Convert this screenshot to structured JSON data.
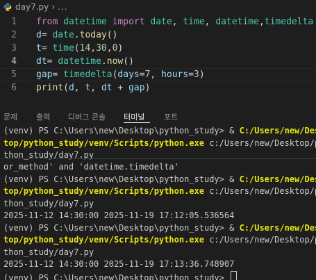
{
  "breadcrumb": {
    "file": "day7.py",
    "more": "..."
  },
  "editor": {
    "lines": [
      {
        "no": "1",
        "tokens": [
          [
            "kw",
            "from"
          ],
          [
            "pl",
            " "
          ],
          [
            "cls",
            "datetime"
          ],
          [
            "pl",
            " "
          ],
          [
            "kw",
            "import"
          ],
          [
            "pl",
            " "
          ],
          [
            "cls",
            "date"
          ],
          [
            "pl",
            ", "
          ],
          [
            "cls",
            "time"
          ],
          [
            "pl",
            ", "
          ],
          [
            "cls",
            "datetime"
          ],
          [
            "pl",
            ","
          ],
          [
            "cls",
            "timedelta"
          ]
        ]
      },
      {
        "no": "2",
        "tokens": [
          [
            "var",
            "d"
          ],
          [
            "pl",
            "= "
          ],
          [
            "cls",
            "date"
          ],
          [
            "pl",
            "."
          ],
          [
            "fn",
            "today"
          ],
          [
            "pl",
            "()"
          ]
        ]
      },
      {
        "no": "3",
        "tokens": [
          [
            "var",
            "t"
          ],
          [
            "pl",
            "= "
          ],
          [
            "cls",
            "time"
          ],
          [
            "pl",
            "("
          ],
          [
            "num",
            "14"
          ],
          [
            "pl",
            ","
          ],
          [
            "num",
            "30"
          ],
          [
            "pl",
            ","
          ],
          [
            "num",
            "0"
          ],
          [
            "pl",
            ")"
          ]
        ]
      },
      {
        "no": "4",
        "tokens": [
          [
            "var",
            "dt"
          ],
          [
            "pl",
            "= "
          ],
          [
            "cls",
            "datetime"
          ],
          [
            "pl",
            "."
          ],
          [
            "fn",
            "now"
          ],
          [
            "pl",
            "()"
          ]
        ]
      },
      {
        "no": "5",
        "tokens": [
          [
            "var",
            "gap"
          ],
          [
            "pl",
            "= "
          ],
          [
            "cls",
            "timedelta"
          ],
          [
            "pl",
            "("
          ],
          [
            "var",
            "days"
          ],
          [
            "pl",
            "="
          ],
          [
            "num",
            "7"
          ],
          [
            "pl",
            ", "
          ],
          [
            "var",
            "hours"
          ],
          [
            "pl",
            "="
          ],
          [
            "num",
            "3"
          ],
          [
            "pl",
            ")"
          ]
        ]
      },
      {
        "no": "6",
        "tokens": [
          [
            "fn",
            "print"
          ],
          [
            "pl",
            "("
          ],
          [
            "var",
            "d"
          ],
          [
            "pl",
            ", "
          ],
          [
            "var",
            "t"
          ],
          [
            "pl",
            ", "
          ],
          [
            "var",
            "dt"
          ],
          [
            "pl",
            " + "
          ],
          [
            "var",
            "gap"
          ],
          [
            "pl",
            ")"
          ]
        ]
      }
    ]
  },
  "panel": {
    "tabs": [
      "문제",
      "출력",
      "디버그 콘솔",
      "터미널",
      "포트"
    ],
    "active": "터미널"
  },
  "terminal": {
    "l0_prefix": "(venv) PS C:\\Users\\new\\Desktop\\python_study> & ",
    "l0_hl": "C:/Users/new/Desk",
    "l1_hl": "top/python_study/venv/Scripts/python.exe",
    "l1_rest": " c:/Users/new/Desktop/py",
    "l2": "thon_study/day7.py",
    "l3": "or_method' and 'datetime.timedelta'",
    "l4_prefix": "(venv) PS C:\\Users\\new\\Desktop\\python_study> & ",
    "l4_hl": "C:/Users/new/Desk",
    "l5_hl": "top/python_study/venv/Scripts/python.exe",
    "l5_rest": " c:/Users/new/Desktop/py",
    "l6": "thon_study/day7.py",
    "l7": "2025-11-12 14:30:00 2025-11-19 17:12:05.536564",
    "l8_prefix": "(venv) PS C:\\Users\\new\\Desktop\\python_study> & ",
    "l8_hl": "C:/Users/new/Desk",
    "l9_hl": "top/python_study/venv/Scripts/python.exe",
    "l9_rest": " c:/Users/new/Desktop/py",
    "l10": "thon_study/day7.py",
    "l11": "2025-11-12 14:30:00 2025-11-19 17:13:36.748907",
    "l12": "(venv) PS C:\\Users\\new\\Desktop\\python_study> "
  }
}
